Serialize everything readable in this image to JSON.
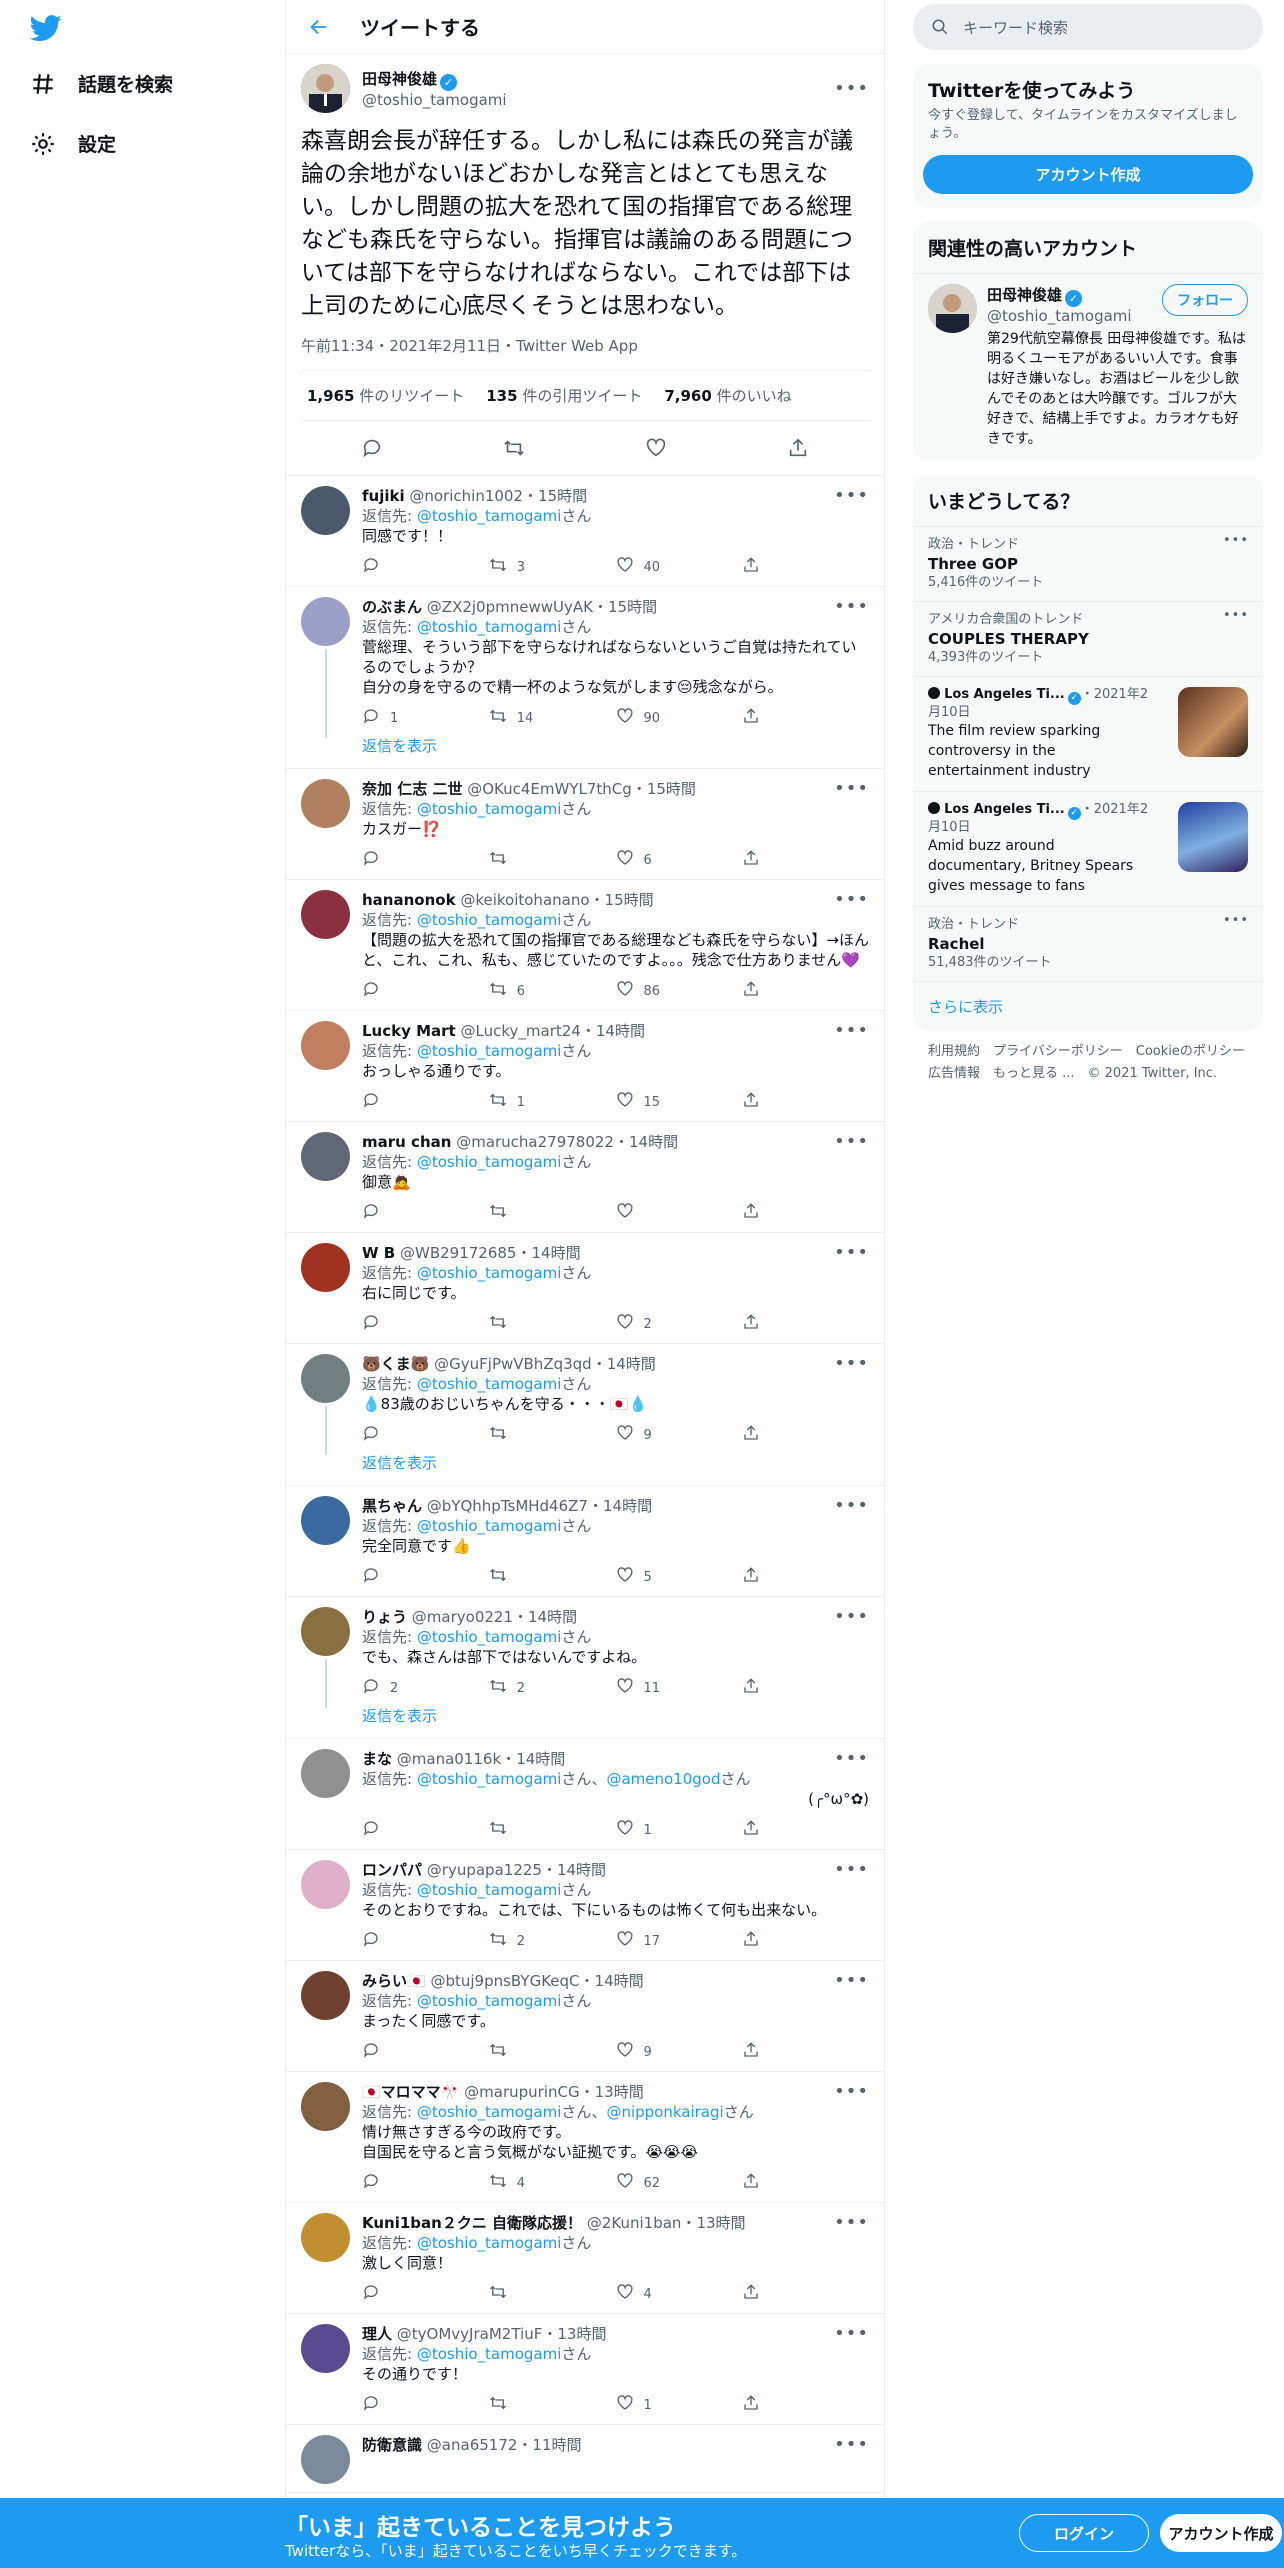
{
  "nav": {
    "explore": "話題を検索",
    "settings": "設定"
  },
  "header": {
    "title": "ツイートする"
  },
  "tweet": {
    "name": "田母神俊雄",
    "handle": "@toshio_tamogami",
    "text": "森喜朗会長が辞任する。しかし私には森氏の発言が議論の余地がないほどおかしな発言とはとても思えない。しかし問題の拡大を恐れて国の指揮官である総理なども森氏を守らない。指揮官は議論のある問題については部下を守らなければならない。これでは部下は上司のために心底尽くそうとは思わない。",
    "meta": "午前11:34・2021年2月11日・Twitter Web App",
    "retweets": "1,965",
    "retweets_label": "件のリツイート",
    "quotes": "135",
    "quotes_label": "件の引用ツイート",
    "likes": "7,960",
    "likes_label": "件のいいね"
  },
  "replies": [
    {
      "name": "fujiki",
      "handle": "@norichin1002",
      "time": "15時間",
      "to": "@toshio_tamogami",
      "san": "さん",
      "reply_prefix": "返信先: ",
      "text": "同感です！！",
      "replies": "",
      "rts": "3",
      "likes": "40",
      "color": "#4a5a6a"
    },
    {
      "name": "のぶまん",
      "handle": "@ZX2j0pmnewwUyAK",
      "time": "15時間",
      "to": "@toshio_tamogami",
      "san": "さん",
      "reply_prefix": "返信先: ",
      "text": "菅総理、そういう部下を守らなければならないというご自覚は持たれているのでしょうか？\n自分の身を守るので精一杯のような気がします😔残念ながら。",
      "replies": "1",
      "rts": "14",
      "likes": "90",
      "color": "#9aa0c8",
      "show": "返信を表示"
    },
    {
      "name": "奈加 仁志 二世",
      "handle": "@OKuc4EmWYL7thCg",
      "time": "15時間",
      "to": "@toshio_tamogami",
      "san": "さん",
      "reply_prefix": "返信先: ",
      "text": "カスガー⁉️",
      "replies": "",
      "rts": "",
      "likes": "6",
      "color": "#b08060"
    },
    {
      "name": "hananonok",
      "handle": "@keikoitohanano",
      "time": "15時間",
      "to": "@toshio_tamogami",
      "san": "さん",
      "reply_prefix": "返信先: ",
      "text": "【問題の拡大を恐れて国の指揮官である総理なども森氏を守らない】→ほんと、これ、これ、私も、感じていたのですよ。。。残念で仕方ありません💜",
      "replies": "",
      "rts": "6",
      "likes": "86",
      "color": "#8a3040"
    },
    {
      "name": "Lucky Mart",
      "handle": "@Lucky_mart24",
      "time": "14時間",
      "to": "@toshio_tamogami",
      "san": "さん",
      "reply_prefix": "返信先: ",
      "text": "おっしゃる通りです。",
      "replies": "",
      "rts": "1",
      "likes": "15",
      "color": "#c08060"
    },
    {
      "name": "maru chan",
      "handle": "@marucha27978022",
      "time": "14時間",
      "to": "@toshio_tamogami",
      "san": "さん",
      "reply_prefix": "返信先: ",
      "text": "御意🙇",
      "replies": "",
      "rts": "",
      "likes": "",
      "color": "#606878"
    },
    {
      "name": "W B",
      "handle": "@WB29172685",
      "time": "14時間",
      "to": "@toshio_tamogami",
      "san": "さん",
      "reply_prefix": "返信先: ",
      "text": "右に同じです。",
      "replies": "",
      "rts": "",
      "likes": "2",
      "color": "#a03020"
    },
    {
      "name": "🐻くま🐻",
      "handle": "@GyuFjPwVBhZq3qd",
      "time": "14時間",
      "to": "@toshio_tamogami",
      "san": "さん",
      "reply_prefix": "返信先: ",
      "text": "💧83歳のおじいちゃんを守る・・・🇯🇵💧",
      "replies": "",
      "rts": "",
      "likes": "9",
      "color": "#708080",
      "show": "返信を表示"
    },
    {
      "name": "黒ちゃん",
      "handle": "@bYQhhpTsMHd46Z7",
      "time": "14時間",
      "to": "@toshio_tamogami",
      "san": "さん",
      "reply_prefix": "返信先: ",
      "text": "完全同意です👍",
      "replies": "",
      "rts": "",
      "likes": "5",
      "color": "#3a6aa0"
    },
    {
      "name": "りょう",
      "handle": "@maryo0221",
      "time": "14時間",
      "to": "@toshio_tamogami",
      "san": "さん",
      "reply_prefix": "返信先: ",
      "text": "でも、森さんは部下ではないんですよね。",
      "replies": "2",
      "rts": "2",
      "likes": "11",
      "color": "#8a7040",
      "show": "返信を表示"
    },
    {
      "name": "まな",
      "handle": "@mana0116k",
      "time": "14時間",
      "to": "@toshio_tamogami",
      "san": "さん",
      "to2": "@ameno10god",
      "san2": "さん",
      "reply_prefix": "返信先: ",
      "text": "(╭°ω°✿)",
      "replies": "",
      "rts": "",
      "likes": "1",
      "color": "#909090"
    },
    {
      "name": "ロンパパ",
      "handle": "@ryupapa1225",
      "time": "14時間",
      "to": "@toshio_tamogami",
      "san": "さん",
      "reply_prefix": "返信先: ",
      "text": "そのとおりですね。これでは、下にいるものは怖くて何も出来ない。",
      "replies": "",
      "rts": "2",
      "likes": "17",
      "color": "#e0b0c8"
    },
    {
      "name": "みらい🇯🇵",
      "handle": "@btuj9pnsBYGKeqC",
      "time": "14時間",
      "to": "@toshio_tamogami",
      "san": "さん",
      "reply_prefix": "返信先: ",
      "text": "まったく同感です。",
      "replies": "",
      "rts": "",
      "likes": "9",
      "color": "#704030"
    },
    {
      "name": "🇯🇵マロママ🎌",
      "handle": "@marupurinCG",
      "time": "13時間",
      "to": "@toshio_tamogami",
      "san": "さん",
      "to2": "@nipponkairagi",
      "san2": "さん",
      "reply_prefix": "返信先: ",
      "text": "情け無さすぎる今の政府です。\n自国民を守ると言う気概がない証拠です。😭😭😭",
      "replies": "",
      "rts": "4",
      "likes": "62",
      "color": "#806040"
    },
    {
      "name": "Kuni1ban２クニ 自衛隊応援！",
      "handle": "@2Kuni1ban",
      "time": "13時間",
      "to": "@toshio_tamogami",
      "san": "さん",
      "reply_prefix": "返信先: ",
      "text": "激しく同意！",
      "replies": "",
      "rts": "",
      "likes": "4",
      "color": "#c09030"
    },
    {
      "name": "理人",
      "handle": "@tyOMvyJraM2TiuF",
      "time": "13時間",
      "to": "@toshio_tamogami",
      "san": "さん",
      "reply_prefix": "返信先: ",
      "text": "その通りです！",
      "replies": "",
      "rts": "",
      "likes": "1",
      "color": "#5a4a90"
    },
    {
      "name": "防衛意識",
      "handle": "@ana65172",
      "time": "11時間",
      "to": "",
      "san": "",
      "reply_prefix": "",
      "text": "",
      "replies": "",
      "rts": "",
      "likes": "",
      "color": "#7a8a9a"
    }
  ],
  "sidebar": {
    "search_placeholder": "キーワード検索",
    "signup": {
      "title": "Twitterを使ってみよう",
      "desc": "今すぐ登録して、タイムラインをカスタマイズしましょう。",
      "button": "アカウント作成"
    },
    "related": {
      "title": "関連性の高いアカウント",
      "name": "田母神俊雄",
      "handle": "@toshio_tamogami",
      "follow": "フォロー",
      "bio": "第29代航空幕僚長 田母神俊雄です。私は明るくユーモアがあるいい人です。食事は好き嫌いなし。お酒はビールを少し飲んでそのあとは大吟醸です。ゴルフが大好きで、結構上手ですよ。カラオケも好きです。"
    },
    "trends": {
      "title": "いまどうしてる？",
      "items": [
        {
          "meta": "政治・トレンド",
          "name": "Three GOP",
          "count": "5,416件のツイート"
        },
        {
          "meta": "アメリカ合衆国のトレンド",
          "name": "COUPLES THERAPY",
          "count": "4,393件のツイート"
        },
        {
          "source": "Los Angeles Ti...",
          "date": "・2021年2月10日",
          "name": "The film review sparking controversy in the entertainment industry"
        },
        {
          "source": "Los Angeles Ti...",
          "date": "・2021年2月10日",
          "name": "Amid buzz around documentary, Britney Spears gives message to fans"
        },
        {
          "meta": "政治・トレンド",
          "name": "Rachel",
          "count": "51,483件のツイート"
        }
      ],
      "more": "さらに表示"
    },
    "footer": {
      "l1": "利用規約　プライバシーポリシー　Cookieのポリシー",
      "l2": "広告情報　もっと見る ...　© 2021 Twitter, Inc."
    }
  },
  "bottom": {
    "title": "「いま」起きていることを見つけよう",
    "sub": "Twitterなら、「いま」起きていることをいち早くチェックできます。",
    "login": "ログイン",
    "signup": "アカウント作成"
  },
  "colors": {
    "accent": "#1d9bf0"
  }
}
